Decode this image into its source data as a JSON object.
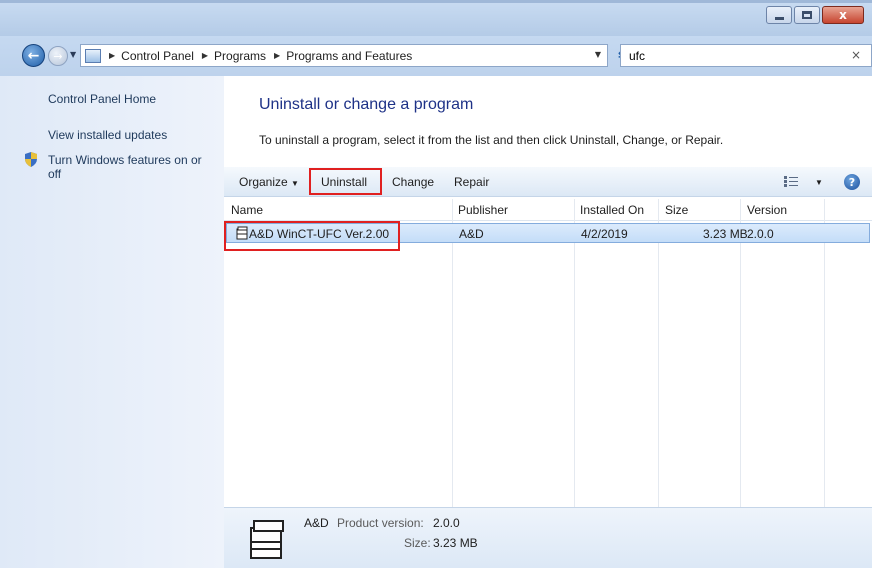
{
  "window": {
    "minimize_glyph": "",
    "close_glyph": "x"
  },
  "nav": {
    "back_glyph": "←",
    "forward_glyph": "→",
    "breadcrumb": [
      "Control Panel",
      "Programs",
      "Programs and Features"
    ],
    "search_value": "ufc",
    "search_clear": "×"
  },
  "sidebar": {
    "links": [
      "Control Panel Home",
      "View installed updates",
      "Turn Windows features on or",
      "off"
    ]
  },
  "main": {
    "title": "Uninstall or change a program",
    "description": "To uninstall a program, select it from the list and then click Uninstall, Change, or Repair."
  },
  "toolbar": {
    "organize": "Organize",
    "uninstall": "Uninstall",
    "change": "Change",
    "repair": "Repair",
    "help": "?"
  },
  "table": {
    "columns": [
      "Name",
      "Publisher",
      "Installed On",
      "Size",
      "Version"
    ],
    "rows": [
      {
        "name": "A&D WinCT-UFC Ver.2.00",
        "publisher": "A&D",
        "installed_on": "4/2/2019",
        "size": "3.23 MB",
        "version": "2.0.0"
      }
    ]
  },
  "details": {
    "publisher": "A&D",
    "version_label": "Product version:",
    "version": "2.0.0",
    "size_label": "Size:",
    "size": "3.23 MB"
  },
  "colors": {
    "accent": "#1e3287",
    "highlight_border": "#e02020",
    "selected_row": "#c4ddf8"
  }
}
